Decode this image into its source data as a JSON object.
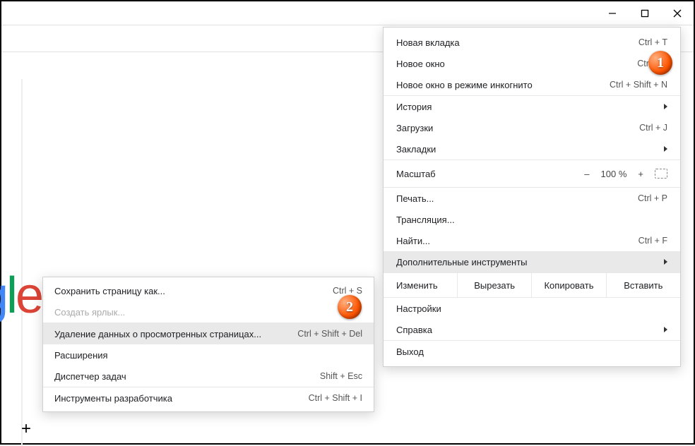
{
  "window": {
    "min": "–",
    "max": "❐",
    "close": "✕"
  },
  "toolbar": {
    "star": "☆",
    "more": "⋮"
  },
  "logo": {
    "g1": "g",
    "l": "l",
    "e": "e"
  },
  "plus": "+",
  "callouts": {
    "one": "1",
    "two": "2"
  },
  "menu": {
    "new_tab": {
      "label": "Новая вкладка",
      "sc": "Ctrl + T"
    },
    "new_window": {
      "label": "Новое окно",
      "sc": "Ctrl + N"
    },
    "incognito": {
      "label": "Новое окно в режиме инкогнито",
      "sc": "Ctrl + Shift + N"
    },
    "history": {
      "label": "История"
    },
    "downloads": {
      "label": "Загрузки",
      "sc": "Ctrl + J"
    },
    "bookmarks": {
      "label": "Закладки"
    },
    "zoom": {
      "label": "Масштаб",
      "minus": "–",
      "value": "100 %",
      "plus": "+"
    },
    "print": {
      "label": "Печать...",
      "sc": "Ctrl + P"
    },
    "cast": {
      "label": "Трансляция..."
    },
    "find": {
      "label": "Найти...",
      "sc": "Ctrl + F"
    },
    "more_tools": {
      "label": "Дополнительные инструменты"
    },
    "edit": {
      "label": "Изменить",
      "cut": "Вырезать",
      "copy": "Копировать",
      "paste": "Вставить"
    },
    "settings": {
      "label": "Настройки"
    },
    "help": {
      "label": "Справка"
    },
    "exit": {
      "label": "Выход"
    }
  },
  "submenu": {
    "save_as": {
      "label": "Сохранить страницу как...",
      "sc": "Ctrl + S"
    },
    "create_shortcut": {
      "label": "Создать ярлык..."
    },
    "clear_data": {
      "label": "Удаление данных о просмотренных страницах...",
      "sc": "Ctrl + Shift + Del"
    },
    "extensions": {
      "label": "Расширения"
    },
    "task_manager": {
      "label": "Диспетчер задач",
      "sc": "Shift + Esc"
    },
    "dev_tools": {
      "label": "Инструменты разработчика",
      "sc": "Ctrl + Shift + I"
    }
  }
}
